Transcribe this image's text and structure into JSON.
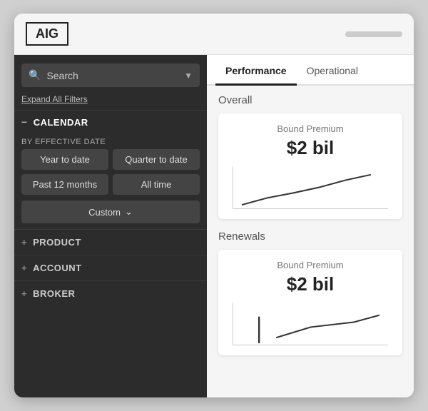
{
  "window": {
    "logo": "AIG"
  },
  "sidebar": {
    "search_placeholder": "Search",
    "expand_filters_label": "Expand All Filters",
    "calendar_section": "CALENDAR",
    "by_effective_date_label": "BY EFFECTIVE DATE",
    "date_buttons": [
      "Year to date",
      "Quarter to date",
      "Past 12 months",
      "All time"
    ],
    "custom_label": "Custom",
    "product_label": "PRODUCT",
    "account_label": "ACCOUNT",
    "broker_label": "BROKER"
  },
  "tabs": [
    {
      "label": "Performance",
      "active": true
    },
    {
      "label": "Operational",
      "active": false
    }
  ],
  "overall": {
    "title": "Overall",
    "card": {
      "label": "Bound Premium",
      "value": "$2 bil"
    }
  },
  "renewals": {
    "title": "Renewals",
    "card": {
      "label": "Bound Premium",
      "value": "$2 bil"
    }
  }
}
